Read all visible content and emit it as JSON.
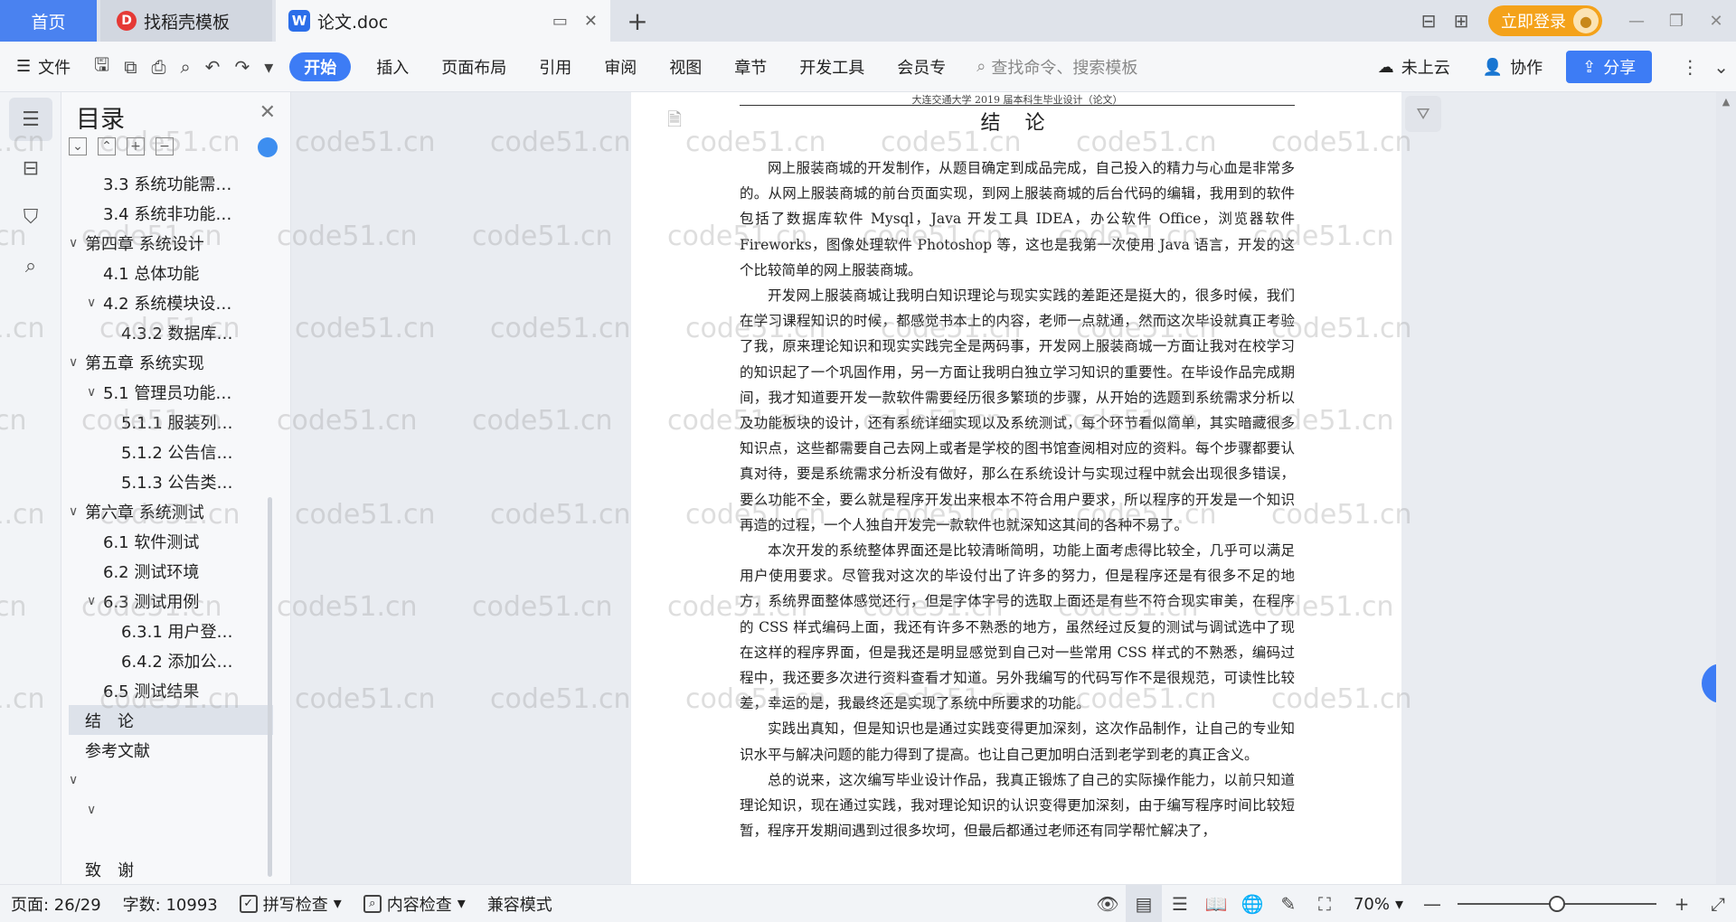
{
  "tabs": {
    "home": "首页",
    "daoke": "找稻壳模板",
    "doc": "论文.doc"
  },
  "titlebar": {
    "login": "立即登录"
  },
  "ribbon": {
    "file": "文件",
    "tabs": [
      "开始",
      "插入",
      "页面布局",
      "引用",
      "审阅",
      "视图",
      "章节",
      "开发工具",
      "会员专"
    ],
    "active_tab": "开始",
    "search": "查找命令、搜索模板",
    "cloud": "未上云",
    "collab": "协作",
    "share": "分享"
  },
  "toc": {
    "title": "目录",
    "items": [
      {
        "label": "3.3 系统功能需…",
        "level": 2,
        "caret": ""
      },
      {
        "label": "3.4 系统非功能…",
        "level": 2,
        "caret": ""
      },
      {
        "label": "第四章 系统设计",
        "level": 1,
        "caret": "v"
      },
      {
        "label": "4.1 总体功能",
        "level": 2,
        "caret": ""
      },
      {
        "label": "4.2 系统模块设…",
        "level": 2,
        "caret": "v"
      },
      {
        "label": "4.3.2 数据库…",
        "level": 3,
        "caret": ""
      },
      {
        "label": "第五章 系统实现",
        "level": 1,
        "caret": "v"
      },
      {
        "label": "5.1 管理员功能…",
        "level": 2,
        "caret": "v"
      },
      {
        "label": "5.1.1 服装列…",
        "level": 3,
        "caret": ""
      },
      {
        "label": "5.1.2 公告信…",
        "level": 3,
        "caret": ""
      },
      {
        "label": "5.1.3 公告类…",
        "level": 3,
        "caret": ""
      },
      {
        "label": "第六章 系统测试",
        "level": 1,
        "caret": "v"
      },
      {
        "label": "6.1 软件测试",
        "level": 2,
        "caret": ""
      },
      {
        "label": "6.2 测试环境",
        "level": 2,
        "caret": ""
      },
      {
        "label": "6.3 测试用例",
        "level": 2,
        "caret": "v"
      },
      {
        "label": "6.3.1 用户登…",
        "level": 3,
        "caret": ""
      },
      {
        "label": "6.4.2 添加公…",
        "level": 3,
        "caret": ""
      },
      {
        "label": "6.5 测试结果",
        "level": 2,
        "caret": ""
      },
      {
        "label": "结　论",
        "level": 1,
        "caret": "",
        "selected": true
      },
      {
        "label": "参考文献",
        "level": 1,
        "caret": ""
      },
      {
        "label": "",
        "level": 1,
        "caret": "v"
      },
      {
        "label": "",
        "level": 2,
        "caret": "v"
      },
      {
        "label": "",
        "level": 1,
        "caret": ""
      },
      {
        "label": "致　谢",
        "level": 1,
        "caret": ""
      }
    ]
  },
  "document": {
    "running_head": "大连交通大学 2019 届本科生毕业设计（论文）",
    "title": "结 论",
    "paragraphs": [
      "网上服装商城的开发制作，从题目确定到成品完成，自己投入的精力与心血是非常多的。从网上服装商城的前台页面实现，到网上服装商城的后台代码的编辑，我用到的软件包括了数据库软件 Mysql，Java 开发工具 IDEA，办公软件 Office，浏览器软件 Fireworks，图像处理软件 Photoshop 等，这也是我第一次使用 Java 语言，开发的这个比较简单的网上服装商城。",
      "开发网上服装商城让我明白知识理论与现实实践的差距还是挺大的，很多时候，我们在学习课程知识的时候，都感觉书本上的内容，老师一点就通，然而这次毕设就真正考验了我，原来理论知识和现实实践完全是两码事，开发网上服装商城一方面让我对在校学习的知识起了一个巩固作用，另一方面让我明白独立学习知识的重要性。在毕设作品完成期间，我才知道要开发一款软件需要经历很多繁琐的步骤，从开始的选题到系统需求分析以及功能板块的设计，还有系统详细实现以及系统测试，每个环节看似简单，其实暗藏很多知识点，这些都需要自己去网上或者是学校的图书馆查阅相对应的资料。每个步骤都要认真对待，要是系统需求分析没有做好，那么在系统设计与实现过程中就会出现很多错误，要么功能不全，要么就是程序开发出来根本不符合用户要求，所以程序的开发是一个知识再造的过程，一个人独自开发完一款软件也就深知这其间的各种不易了。",
      "本次开发的系统整体界面还是比较清晰简明，功能上面考虑得比较全，几乎可以满足用户使用要求。尽管我对这次的毕设付出了许多的努力，但是程序还是有很多不足的地方，系统界面整体感觉还行，但是字体字号的选取上面还是有些不符合现实审美，在程序的 CSS 样式编码上面，我还有许多不熟悉的地方，虽然经过反复的测试与调试选中了现在这样的程序界面，但是我还是明显感觉到自己对一些常用 CSS 样式的不熟悉，编码过程中，我还要多次进行资料查看才知道。另外我编写的代码写作不是很规范，可读性比较差，幸运的是，我最终还是实现了系统中所要求的功能。",
      "实践出真知，但是知识也是通过实践变得更加深刻，这次作品制作，让自己的专业知识水平与解决问题的能力得到了提高。也让自己更加明白活到老学到老的真正含义。",
      "总的说来，这次编写毕业设计作品，我真正锻炼了自己的实际操作能力，以前只知道理论知识，现在通过实践，我对理论知识的认识变得更加深刻，由于编写程序时间比较短暂，程序开发期间遇到过很多坎坷，但最后都通过老师还有同学帮忙解决了，"
    ]
  },
  "watermark": "code51.cn",
  "status": {
    "page": "页面: 26/29",
    "words": "字数: 10993",
    "spell": "拼写检查",
    "content_check": "内容检查",
    "compat": "兼容模式",
    "zoom": "70%",
    "zoom_level": 0.5
  }
}
